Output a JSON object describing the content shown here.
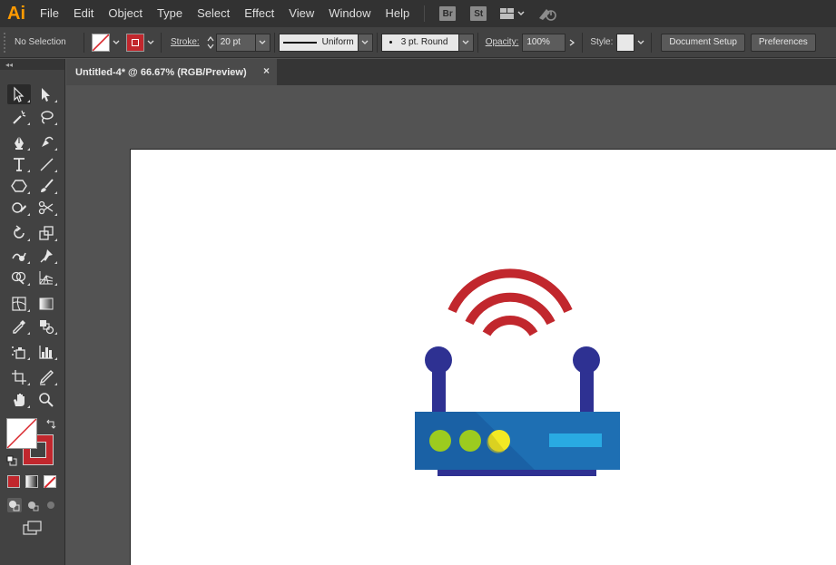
{
  "app": {
    "logo": "Ai"
  },
  "menu": [
    "File",
    "Edit",
    "Object",
    "Type",
    "Select",
    "Effect",
    "View",
    "Window",
    "Help"
  ],
  "menu_icons": [
    "Br",
    "St"
  ],
  "control_bar": {
    "selection_label": "No Selection",
    "stroke_label": "Stroke:",
    "stroke_value": "20 pt",
    "profile_label": "Uniform",
    "brush_label": "3 pt. Round",
    "opacity_label": "Opacity:",
    "opacity_value": "100%",
    "style_label": "Style:",
    "document_setup": "Document Setup",
    "preferences": "Preferences"
  },
  "tab": {
    "title": "Untitled-4* @ 66.67% (RGB/Preview)",
    "close": "×"
  },
  "colors": {
    "accent_red": "#c1272d",
    "router_body": "#1e6fb3",
    "router_base": "#2e3192",
    "antenna": "#2e3192",
    "led_green": "#9ccb1f",
    "led_yellow": "#f3e924",
    "display_bar": "#29aae2"
  },
  "tools": [
    "selection-tool",
    "direct-selection-tool",
    "magic-wand-tool",
    "lasso-tool",
    "pen-tool",
    "curvature-tool",
    "type-tool",
    "line-segment-tool",
    "polygon-tool",
    "paintbrush-tool",
    "shaper-tool",
    "scissors-tool",
    "rotate-tool",
    "scale-tool",
    "warp-tool",
    "puppet-warp-tool",
    "shape-builder-tool",
    "perspective-grid-tool",
    "mesh-tool",
    "gradient-tool",
    "eyedropper-tool",
    "blend-tool",
    "symbol-sprayer-tool",
    "column-graph-tool",
    "artboard-tool",
    "slice-tool",
    "hand-tool",
    "zoom-tool"
  ]
}
